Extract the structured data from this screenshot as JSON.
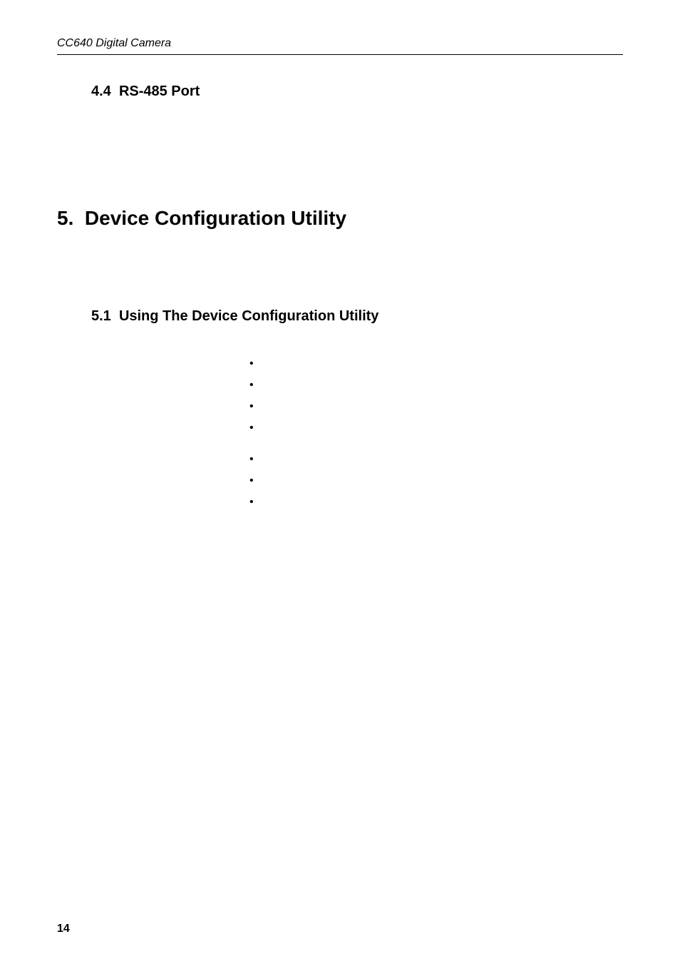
{
  "header": {
    "running_head": "CC640 Digital Camera"
  },
  "sections": {
    "s44": {
      "number": "4.4",
      "title": "RS-485 Port"
    },
    "s5": {
      "number": "5.",
      "title": "Device Configuration Utility"
    },
    "s51": {
      "number": "5.1",
      "title": "Using The Device Configuration Utility"
    }
  },
  "bullets": [
    "",
    "",
    "",
    "",
    "",
    "",
    ""
  ],
  "page_number": "14"
}
